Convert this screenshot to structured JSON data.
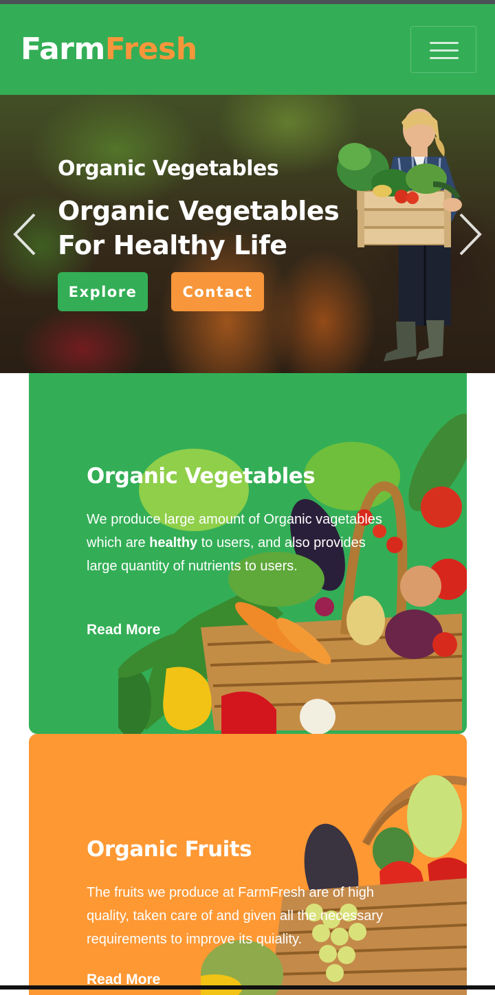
{
  "navbar": {
    "brand_part1": "Farm",
    "brand_part2": "Fresh",
    "menu_icon": "hamburger-menu-icon"
  },
  "hero": {
    "subtitle": "Organic Vegetables",
    "title": "Organic Vegetables For Healthy Life",
    "explore_label": "Explore",
    "contact_label": "Contact",
    "prev_icon": "chevron-left-icon",
    "next_icon": "chevron-right-icon"
  },
  "cards": [
    {
      "title": "Organic Vegetables",
      "text_before": "We produce large amount of Organic vagetables which are ",
      "text_bold": "healthy",
      "text_after": " to users, and also provides large quantity of nutrients to users.",
      "link": "Read More"
    },
    {
      "title": "Organic Fruits",
      "text": "The fruits we produce at FarmFresh are of high quality, taken care of and given all the necessary requirements to improve its quiality.",
      "link": "Read More"
    }
  ],
  "colors": {
    "green": "#33ae56",
    "orange": "#f7963a",
    "card_orange": "#fd9833"
  }
}
